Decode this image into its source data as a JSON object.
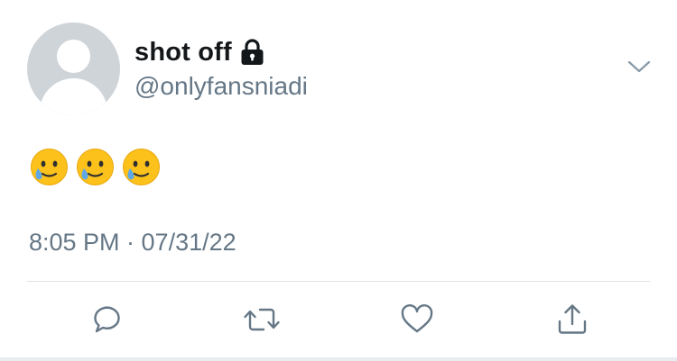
{
  "tweet": {
    "author": {
      "display_name": "shot off",
      "handle": "@onlyfansniadi",
      "protected_icon": "lock-icon",
      "avatar": "default-avatar"
    },
    "text": "🥲🥲🥲",
    "emoji": [
      "smiling-face-with-tear",
      "smiling-face-with-tear",
      "smiling-face-with-tear"
    ],
    "timestamp": "8:05 PM · 07/31/22",
    "menu_icon": "chevron-down-icon",
    "actions": [
      {
        "name": "reply",
        "icon": "reply-icon"
      },
      {
        "name": "retweet",
        "icon": "retweet-icon"
      },
      {
        "name": "like",
        "icon": "heart-icon"
      },
      {
        "name": "share",
        "icon": "share-icon"
      }
    ]
  },
  "colors": {
    "text_primary": "#14171a",
    "text_secondary": "#657786",
    "icon_gray": "#657786",
    "divider": "#dfe3e7",
    "avatar_bg": "#cfd4d9",
    "emoji_face": "#fcc21b",
    "emoji_tear": "#5fa8e8"
  }
}
